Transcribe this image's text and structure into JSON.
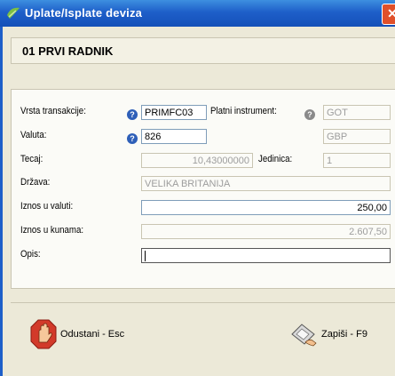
{
  "window": {
    "title": "Uplate/Isplate deviza",
    "close_glyph": "✕"
  },
  "header": {
    "title": "01  PRVI RADNIK"
  },
  "form": {
    "vrsta_label": "Vrsta transakcije:",
    "vrsta_value": "PRIMFC03",
    "platni_label": "Platni instrument:",
    "platni_value": "GOT",
    "valuta_label": "Valuta:",
    "valuta_value": "826",
    "valuta_name": "GBP",
    "tecaj_label": "Tecaj:",
    "tecaj_value": "10,43000000",
    "jedinica_label": "Jedinica:",
    "jedinica_value": "1",
    "drzava_label": "Država:",
    "drzava_value": "VELIKA BRITANIJA",
    "iznos_valuti_label": "Iznos u valuti:",
    "iznos_valuti_value": "250,00",
    "iznos_kunama_label": "Iznos u kunama:",
    "iznos_kunama_value": "2.607,50",
    "opis_label": "Opis:",
    "opis_value": "",
    "help_glyph": "?"
  },
  "buttons": {
    "cancel_label": "Odustani - Esc",
    "save_label": "Zapiši - F9"
  },
  "colors": {
    "titlebar": "#1e5fc9",
    "close": "#e0502a",
    "help_active": "#2e5fb8",
    "help_disabled": "#8a8a8a"
  },
  "icons": {
    "title": "app-icon",
    "cancel": "stop-hand-icon",
    "save": "diskette-hand-icon",
    "help": "help-icon"
  }
}
